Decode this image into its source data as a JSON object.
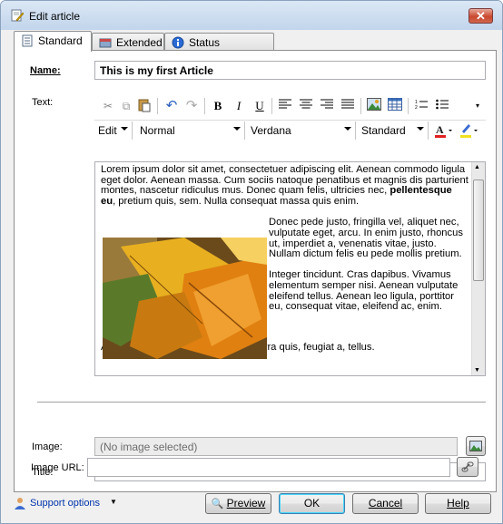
{
  "window": {
    "title": "Edit article",
    "close_label": "✕"
  },
  "tabs": [
    {
      "label": "Standard"
    },
    {
      "label": "Extended"
    },
    {
      "label": "Status information"
    }
  ],
  "form": {
    "name_label": "Name:",
    "name_value": "This is my first Article",
    "text_label": "Text:",
    "image_label": "Image:",
    "image_value": "(No image selected)",
    "title_label": "Title:",
    "title_value": "",
    "image_url_label": "Image URL:",
    "image_url_value": ""
  },
  "editor_toolbar": {
    "edit_menu": "Edit",
    "style": "Normal",
    "font": "Verdana",
    "size": "Standard",
    "bold": "B",
    "italic": "I",
    "underline": "U"
  },
  "editor": {
    "para1_a": "Lorem ipsum dolor sit amet, consectetuer adipiscing elit. Aenean commodo ligula eget dolor. Aenean massa. Cum sociis natoque penatibus et magnis dis parturient montes, nascetur ridiculus mus. Donec quam felis, ultricies nec,",
    "para1_bold": "pellentesque eu",
    "para1_b": ", pretium quis, sem. Nulla consequat massa quis enim.",
    "para2": "Donec pede justo, fringilla vel, aliquet nec, vulputate eget, arcu. In enim justo, rhoncus ut, imperdiet a, venenatis vitae, justo. Nullam dictum felis eu pede mollis pretium.",
    "para3": "Integer tincidunt. Cras dapibus. Vivamus elementum semper nisi. Aenean vulputate eleifend tellus. Aenean leo ligula, porttitor eu, consequat vitae, eleifend ac, enim.",
    "para4": "Aliquam lorem ante, dapibus in, viverra quis, feugiat a, tellus."
  },
  "footer": {
    "support": "Support options",
    "preview": "Preview",
    "ok": "OK",
    "cancel": "Cancel",
    "help": "Help"
  },
  "colors": {
    "accent": "#1f5bc1",
    "link": "#0033aa"
  }
}
